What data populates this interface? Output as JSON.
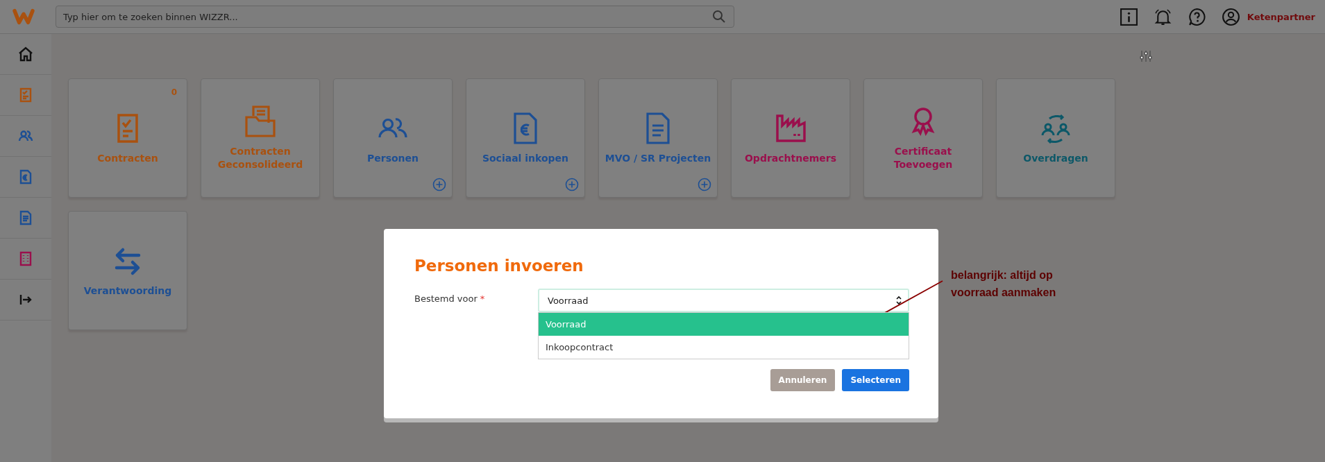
{
  "topbar": {
    "search": {
      "placeholder": "Typ hier om te zoeken binnen WIZZR..."
    },
    "user_label": "Ketenpartner"
  },
  "sidebar": {
    "items": [
      {
        "kind": "home",
        "color": "#111111"
      },
      {
        "kind": "checklist",
        "color": "#a9510f"
      },
      {
        "kind": "people",
        "color": "#1d4f94"
      },
      {
        "kind": "euro",
        "color": "#1d4f94"
      },
      {
        "kind": "document",
        "color": "#1d4f94"
      },
      {
        "kind": "building",
        "color": "#9a0f4c"
      },
      {
        "kind": "logout",
        "color": "#111111"
      }
    ]
  },
  "tiles": [
    {
      "kind": "checklist",
      "label_lines": [
        "Contracten"
      ],
      "color": "#a9510f",
      "badge": "0",
      "add": false
    },
    {
      "kind": "folder",
      "label_lines": [
        "Contracten",
        "Geconsolideerd"
      ],
      "color": "#a9510f",
      "add": false
    },
    {
      "kind": "people",
      "label_lines": [
        "Personen"
      ],
      "color": "#1d4f94",
      "add": true
    },
    {
      "kind": "euro",
      "label_lines": [
        "Sociaal inkopen"
      ],
      "color": "#1d4f94",
      "add": true
    },
    {
      "kind": "document",
      "label_lines": [
        "MVO / SR Projecten"
      ],
      "color": "#1d4f94",
      "add": true
    },
    {
      "kind": "factory",
      "label_lines": [
        "Opdrachtnemers"
      ],
      "color": "#9a0f4c",
      "add": false
    },
    {
      "kind": "award",
      "label_lines": [
        "Certificaat",
        "Toevoegen"
      ],
      "color": "#9a0f4c",
      "add": false
    },
    {
      "kind": "transfer",
      "label_lines": [
        "Overdragen"
      ],
      "color": "#0c5868",
      "add": false
    },
    {
      "kind": "swap",
      "label_lines": [
        "Verantwoording"
      ],
      "color": "#1d4f94",
      "add": false
    }
  ],
  "modal": {
    "title": "Personen invoeren",
    "field": {
      "label": "Bestemd voor",
      "required_mark": "*",
      "value": "Voorraad",
      "options": [
        {
          "label": "Voorraad",
          "selected": true
        },
        {
          "label": "Inkoopcontract",
          "selected": false
        }
      ]
    },
    "buttons": [
      {
        "label": "Annuleren",
        "disabled": true
      },
      {
        "label": "Selecteren",
        "disabled": false
      }
    ]
  },
  "annotation": {
    "lines": [
      "belangrijk: altijd op",
      "voorraad aanmaken"
    ]
  }
}
